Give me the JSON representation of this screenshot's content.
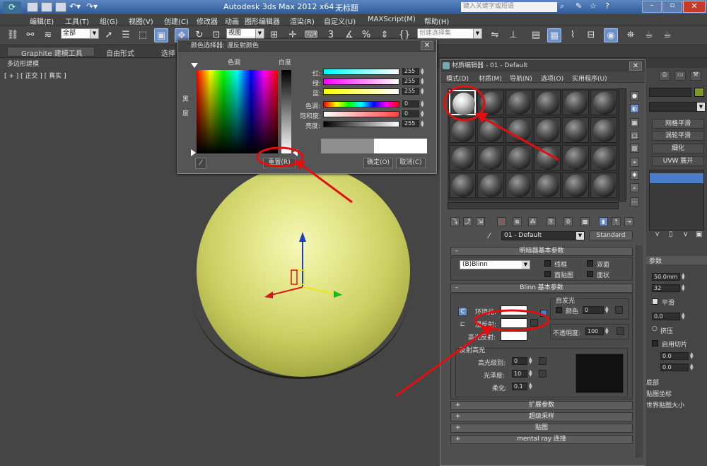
{
  "window": {
    "title_app": "Autodesk 3ds Max  2012 x64",
    "title_doc": "无标题",
    "search_placeholder": "键入关键字或短语"
  },
  "menu": [
    "编辑(E)",
    "工具(T)",
    "组(G)",
    "视图(V)",
    "创建(C)",
    "修改器",
    "动画",
    "图形编辑器",
    "渲染(R)",
    "自定义(U)",
    "MAXScript(M)",
    "帮助(H)"
  ],
  "toolbar": {
    "selection_filter": "全部",
    "reference_coord": "视图",
    "named_selection": "创建选择集",
    "snap_value": "3",
    "angle_snap_value": "%"
  },
  "ribbon": {
    "tabs": [
      "Graphite 建模工具",
      "自由形式",
      "选择"
    ],
    "subtab": "多边形建模"
  },
  "viewport": {
    "label": "[ + ] [ 正交 ] [ 真实 ]"
  },
  "color_dialog": {
    "title": "颜色选择器: 漫反射颜色",
    "hue_label": "色调",
    "whiteness_label": "白度",
    "blackness_label": "黑 度",
    "channels": [
      {
        "label": "红:",
        "value": "255"
      },
      {
        "label": "绿:",
        "value": "255"
      },
      {
        "label": "蓝:",
        "value": "255"
      },
      {
        "label": "色调:",
        "value": "0"
      },
      {
        "label": "饱和度:",
        "value": "0"
      },
      {
        "label": "亮度:",
        "value": "255"
      }
    ],
    "reset_button": "重置(R)",
    "ok_button": "确定(O)",
    "cancel_button": "取消(C)"
  },
  "material_editor": {
    "title": "材质编辑器 - 01 - Default",
    "menu": [
      "模式(D)",
      "材质(M)",
      "导航(N)",
      "选项(O)",
      "实用程序(U)"
    ],
    "material_name": "01 - Default",
    "material_type": "Standard",
    "shader_rollout": "明暗器基本参数",
    "shader_type": "(B)Blinn",
    "shader_options": [
      "线框",
      "双面",
      "面贴图",
      "面状"
    ],
    "blinn_rollout": "Blinn 基本参数",
    "self_illum_label": "自发光",
    "self_illum_color_label": "颜色",
    "self_illum_value": "0",
    "ambient_label": "环境光:",
    "diffuse_label": "漫反射:",
    "specular_label": "高光反射:",
    "opacity_label": "不透明度:",
    "opacity_value": "100",
    "spec_highlights_label": "反射高光",
    "spec_level_label": "高光级别:",
    "spec_level_value": "0",
    "glossiness_label": "光泽度:",
    "glossiness_value": "10",
    "soften_label": "柔化:",
    "soften_value": "0.1",
    "rollouts": [
      "扩展参数",
      "超级采样",
      "贴图",
      "mental ray 连接"
    ]
  },
  "command_panel": {
    "buttons": [
      "网格平滑",
      "涡轮平滑",
      "细化",
      "UVW 展开"
    ],
    "params_label": "参数",
    "radius_value": "50.0mm",
    "segments_value": "32",
    "smooth_label": "平滑",
    "hemisphere_value": "0.0",
    "squash_label": "挤压",
    "slice_label": "启用切片",
    "slice_from": "0.0",
    "slice_to": "0.0",
    "base_pivot_label": "底部",
    "map_coords_label": "贴图坐标",
    "real_world_label": "世界贴图大小"
  },
  "colors": {
    "selection_highlight": "#6b8fc7",
    "annotation_red": "#e01010",
    "sphere_yellow": "#d6d96f"
  }
}
